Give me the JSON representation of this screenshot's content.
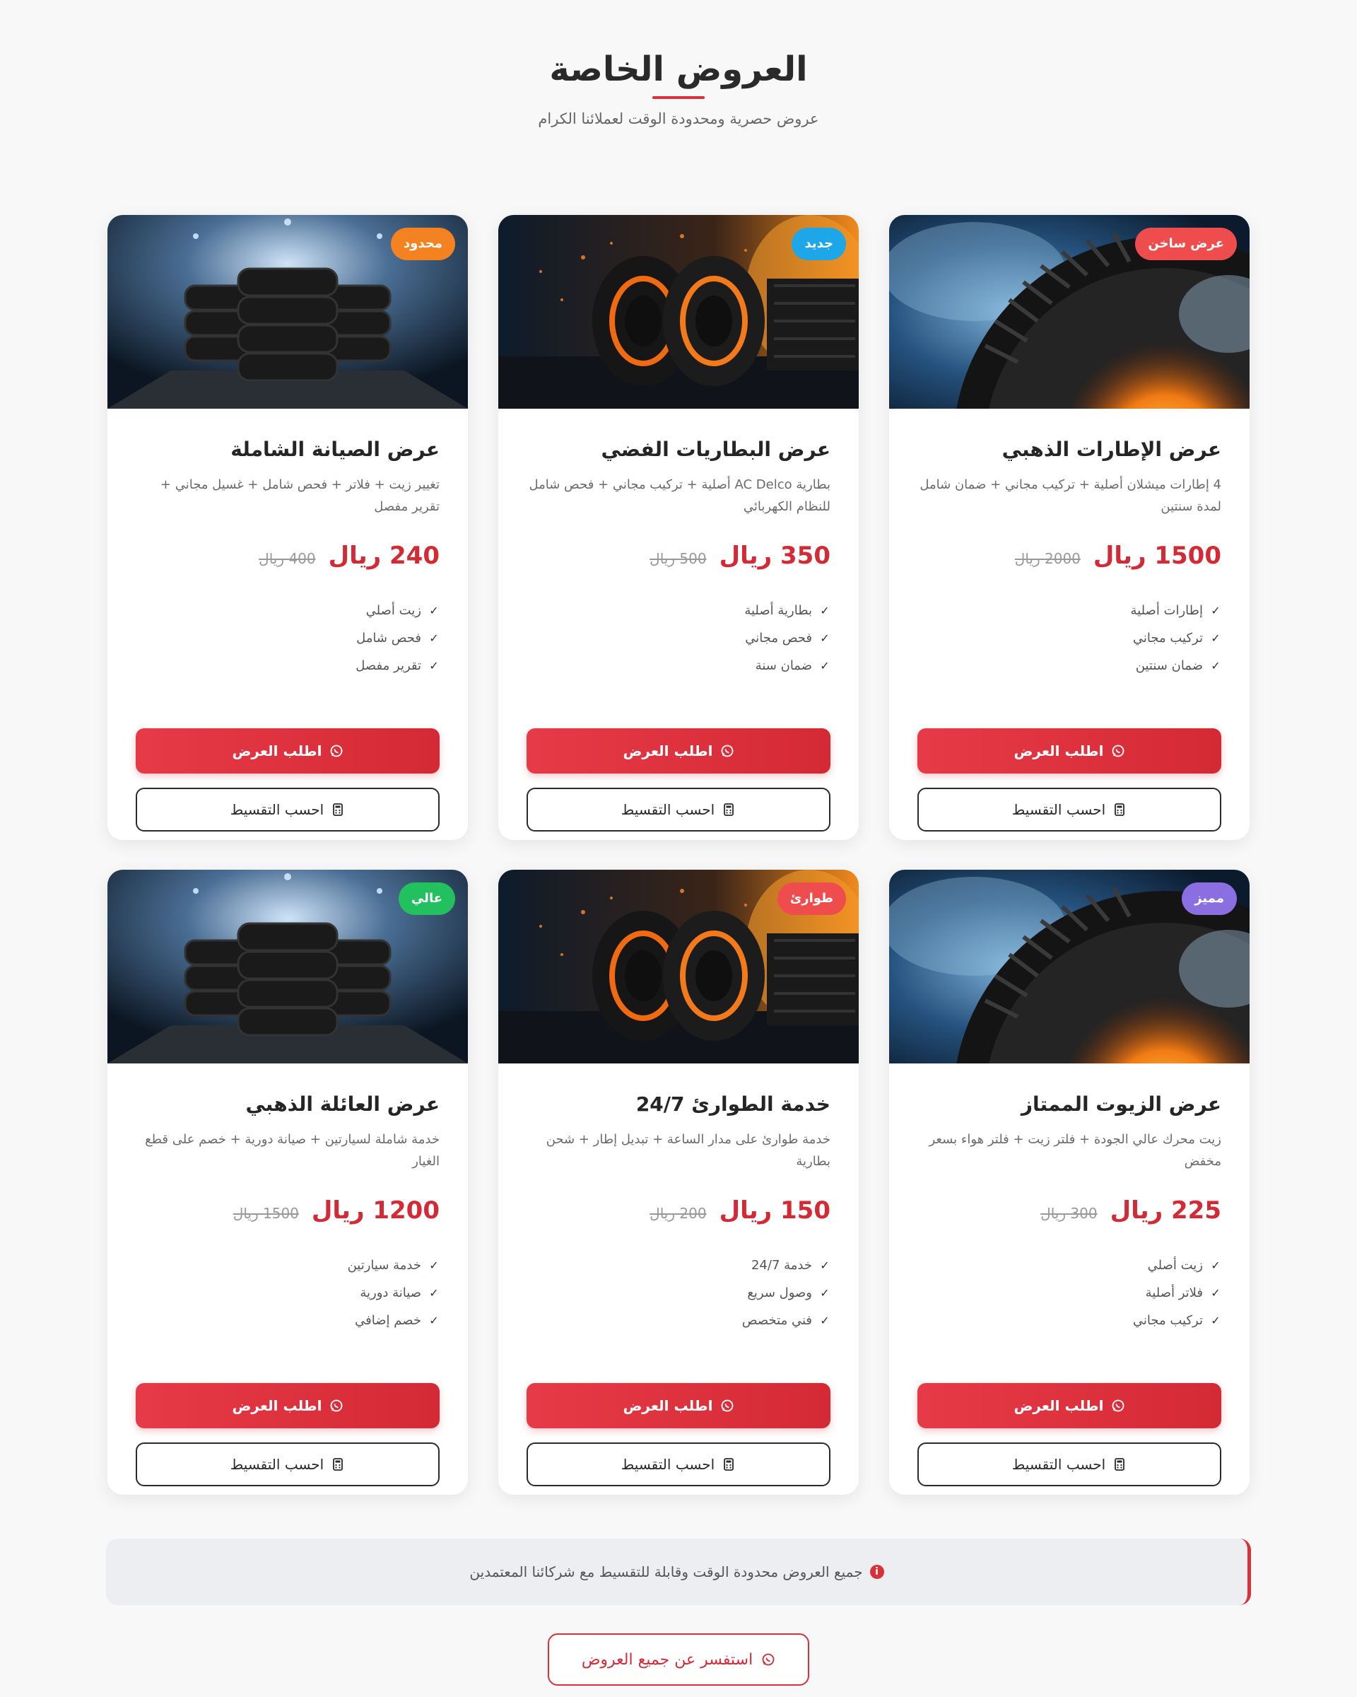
{
  "header": {
    "title": "العروض الخاصة",
    "subtitle": "عروض حصرية ومحدودة الوقت لعملائنا الكرام"
  },
  "labels": {
    "order_button": "اطلب العرض",
    "installment_button": "احسب التقسيط",
    "currency": "ريال"
  },
  "colors": {
    "accent": "#d42a35",
    "badge_hot": "#ef4d4d",
    "badge_new": "#1ea7e8",
    "badge_limited": "#f58220",
    "badge_featured": "#8b6fe0",
    "badge_emergency": "#ef4d4d",
    "badge_high": "#22c05f"
  },
  "offers": [
    {
      "badge": "عرض ساخن",
      "image": "tire-closeup-smoke",
      "title": "عرض الإطارات الذهبي",
      "description": "4 إطارات ميشلان أصلية + تركيب مجاني + ضمان شامل لمدة سنتين",
      "price": "1500 ريال",
      "old_price": "2000 ريال",
      "features": [
        "إطارات أصلية",
        "تركيب مجاني",
        "ضمان سنتين"
      ]
    },
    {
      "badge": "جديد",
      "image": "tires-orange-glow",
      "title": "عرض البطاريات الفضي",
      "description": "بطارية AC Delco أصلية + تركيب مجاني + فحص شامل للنظام الكهربائي",
      "price": "350 ريال",
      "old_price": "500 ريال",
      "features": [
        "بطارية أصلية",
        "فحص مجاني",
        "ضمان سنة"
      ]
    },
    {
      "badge": "محدود",
      "image": "tire-stack-spotlight",
      "title": "عرض الصيانة الشاملة",
      "description": "تغيير زيت + فلاتر + فحص شامل + غسيل مجاني + تقرير مفصل",
      "price": "240 ريال",
      "old_price": "400 ريال",
      "features": [
        "زيت أصلي",
        "فحص شامل",
        "تقرير مفصل"
      ]
    },
    {
      "badge": "مميز",
      "image": "tire-closeup-smoke",
      "title": "عرض الزيوت الممتاز",
      "description": "زيت محرك عالي الجودة + فلتر زيت + فلتر هواء بسعر مخفض",
      "price": "225 ريال",
      "old_price": "300 ريال",
      "features": [
        "زيت أصلي",
        "فلاتر أصلية",
        "تركيب مجاني"
      ]
    },
    {
      "badge": "طوارئ",
      "image": "tires-orange-glow",
      "title": "خدمة الطوارئ 24/7",
      "description": "خدمة طوارئ على مدار الساعة + تبديل إطار + شحن بطارية",
      "price": "150 ريال",
      "old_price": "200 ريال",
      "features": [
        "خدمة 24/7",
        "وصول سريع",
        "فني متخصص"
      ]
    },
    {
      "badge": "عالي",
      "image": "tire-stack-spotlight",
      "title": "عرض العائلة الذهبي",
      "description": "خدمة شاملة لسيارتين + صيانة دورية + خصم على قطع الغيار",
      "price": "1200 ريال",
      "old_price": "1500 ريال",
      "features": [
        "خدمة سيارتين",
        "صيانة دورية",
        "خصم إضافي"
      ]
    }
  ],
  "notice": "جميع العروض محدودة الوقت وقابلة للتقسيط مع شركائنا المعتمدين",
  "cta": "استفسر عن جميع العروض"
}
